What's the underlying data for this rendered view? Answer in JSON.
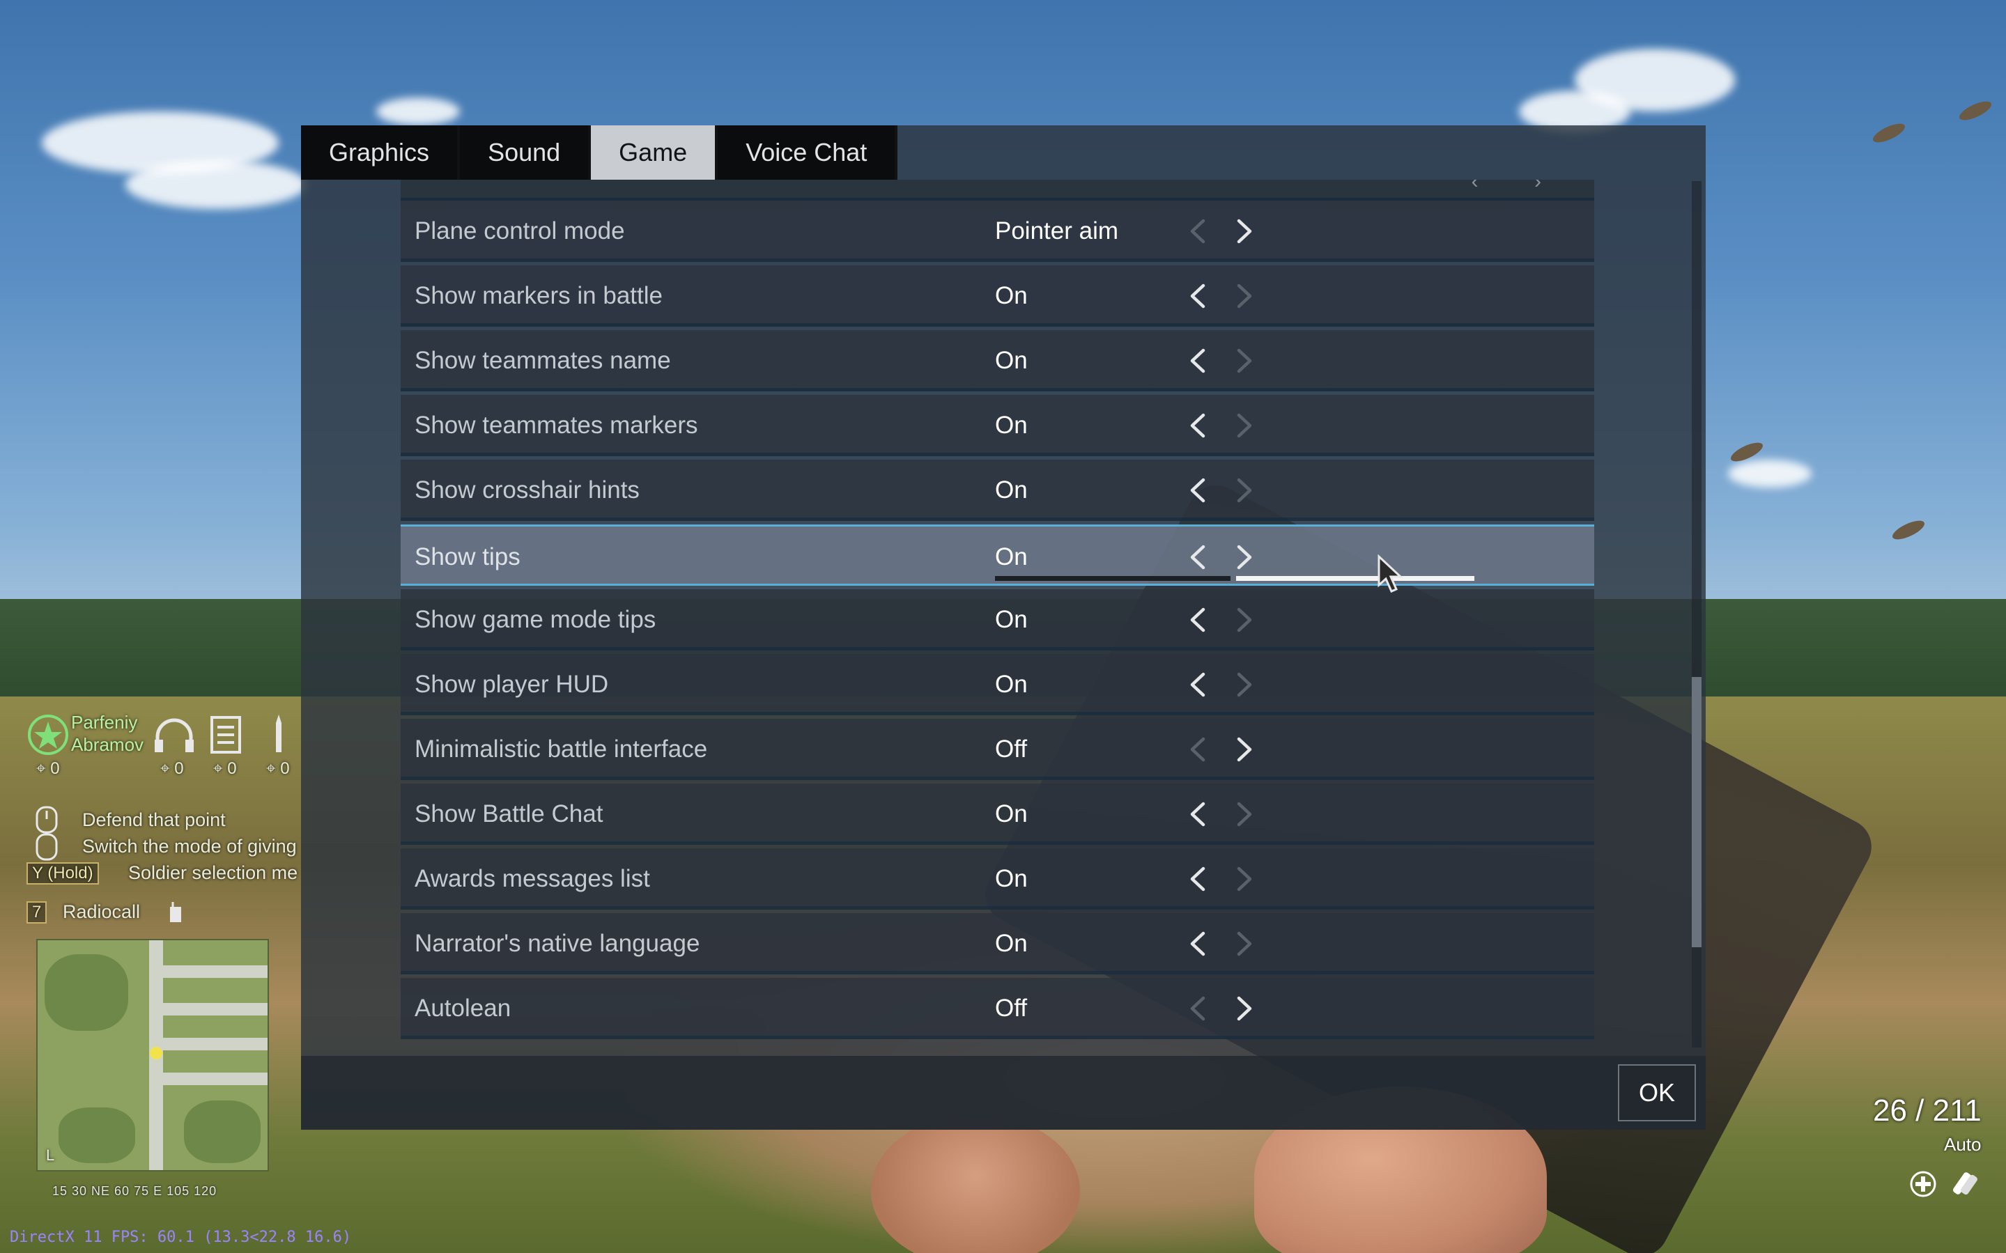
{
  "tabs": [
    {
      "label": "Graphics",
      "active": false
    },
    {
      "label": "Sound",
      "active": false
    },
    {
      "label": "Game",
      "active": true
    },
    {
      "label": "Voice Chat",
      "active": false
    }
  ],
  "settings": [
    {
      "label": "Plane control mode",
      "value": "Pointer aim",
      "left_enabled": false,
      "right_enabled": true
    },
    {
      "label": "Show markers in battle",
      "value": "On",
      "left_enabled": true,
      "right_enabled": false
    },
    {
      "label": "Show teammates name",
      "value": "On",
      "left_enabled": true,
      "right_enabled": false
    },
    {
      "label": "Show teammates markers",
      "value": "On",
      "left_enabled": true,
      "right_enabled": false
    },
    {
      "label": "Show crosshair hints",
      "value": "On",
      "left_enabled": true,
      "right_enabled": false
    },
    {
      "label": "Show tips",
      "value": "On",
      "left_enabled": true,
      "right_enabled": true,
      "highlighted": true,
      "slider_fraction": 0.5
    },
    {
      "label": "Show game mode tips",
      "value": "On",
      "left_enabled": true,
      "right_enabled": false
    },
    {
      "label": "Show player HUD",
      "value": "On",
      "left_enabled": true,
      "right_enabled": false
    },
    {
      "label": "Minimalistic battle interface",
      "value": "Off",
      "left_enabled": false,
      "right_enabled": true
    },
    {
      "label": "Show Battle Chat",
      "value": "On",
      "left_enabled": true,
      "right_enabled": false
    },
    {
      "label": "Awards messages list",
      "value": "On",
      "left_enabled": true,
      "right_enabled": false
    },
    {
      "label": "Narrator's native language",
      "value": "On",
      "left_enabled": true,
      "right_enabled": false
    },
    {
      "label": "Autolean",
      "value": "Off",
      "left_enabled": false,
      "right_enabled": true
    }
  ],
  "footer": {
    "ok_label": "OK"
  },
  "hud": {
    "squad_name_first": "Parfeniy",
    "squad_name_last": "Abramov",
    "counters": [
      "0",
      "0",
      "0",
      "0"
    ],
    "order_1": "Defend that point",
    "order_2": "Switch the mode of giving",
    "order_3_key": "Y  (Hold)",
    "order_3": "Soldier selection me",
    "radio_key": "7",
    "radio_label": "Radiocall",
    "compass": "15   30  NE  60   75   E   105  120",
    "minimap_corner": "L",
    "ammo": "26 / 211",
    "fire_mode": "Auto",
    "fps": "DirectX 11 FPS: 60.1 (13.3<22.8 16.6)"
  },
  "colors": {
    "accent": "#5aaed8",
    "active_tab_bg": "#c9cdd2",
    "highlight_row_bg": "#6c788a",
    "squad_name": "#b9f3a1"
  }
}
